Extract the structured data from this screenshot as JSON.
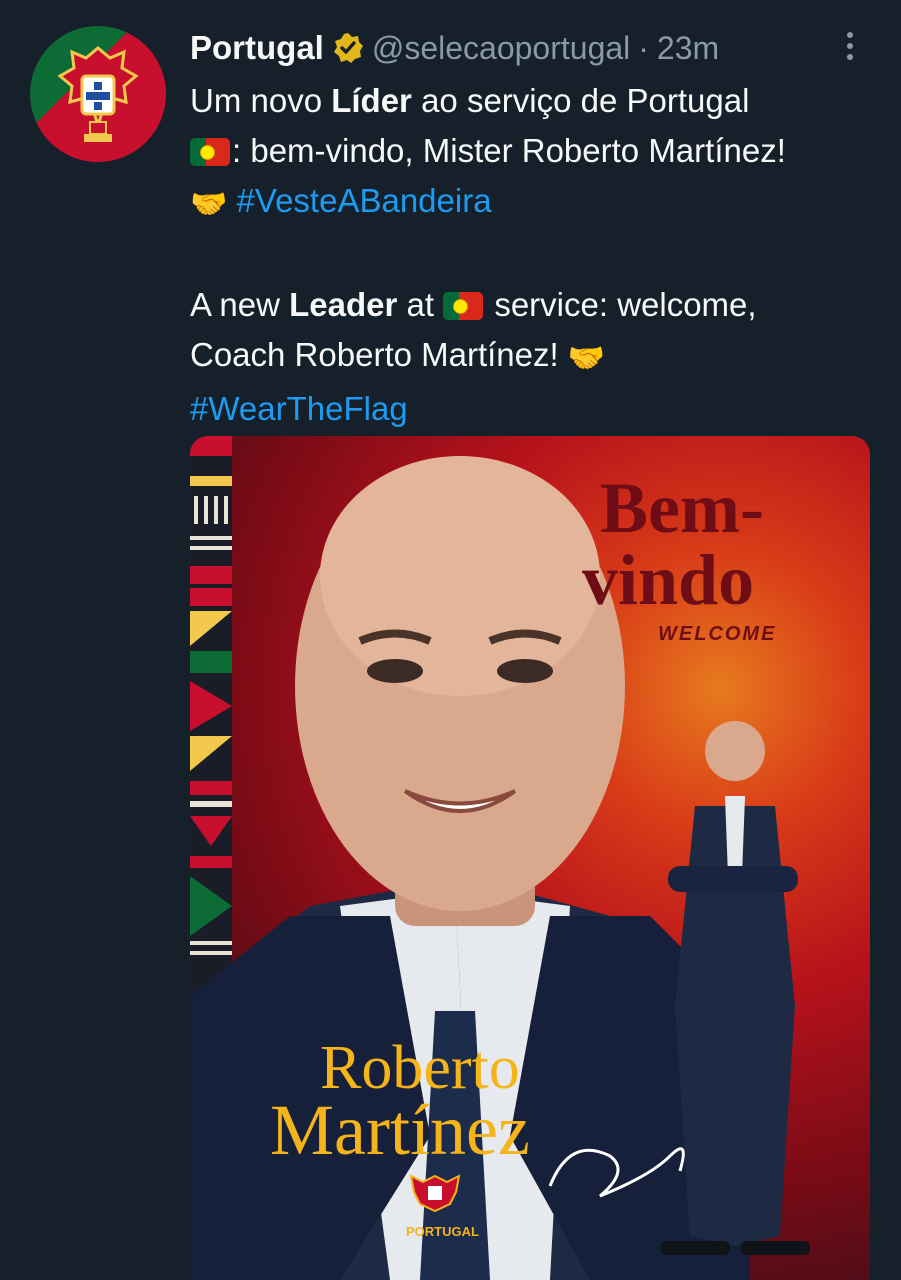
{
  "account": {
    "name": "Portugal",
    "handle": "@selecaoportugal",
    "separator": "·",
    "time": "23m"
  },
  "tweet": {
    "pt_line1_prefix": "Um novo ",
    "pt_bold": "Líder",
    "pt_line1_suffix": " ao serviço de Portugal",
    "pt_line2": ": bem-vindo, Mister Roberto Martínez!",
    "hashtag_pt": "#VesteABandeira",
    "en_prefix": "A new ",
    "en_bold": "Leader",
    "en_mid": " at ",
    "en_suffix": " service: welcome,",
    "en_line2": "Coach Roberto Martínez! ",
    "hashtag_en": "#WearTheFlag",
    "handshake_emoji": "🤝"
  },
  "media": {
    "title_line1": "Bem-",
    "title_line2": "vindo",
    "subtitle": "WELCOME",
    "name_line1": "Roberto",
    "name_line2": "Martínez",
    "crest_label": "PORTUGAL"
  },
  "colors": {
    "background": "#15202b",
    "text": "#f7f9f9",
    "muted": "#8b98a5",
    "link": "#1d9bf0",
    "verified": "#e2b719",
    "gold": "#f4b41a"
  },
  "icons": {
    "verified": "verified-badge-icon",
    "more": "more-options-icon"
  }
}
